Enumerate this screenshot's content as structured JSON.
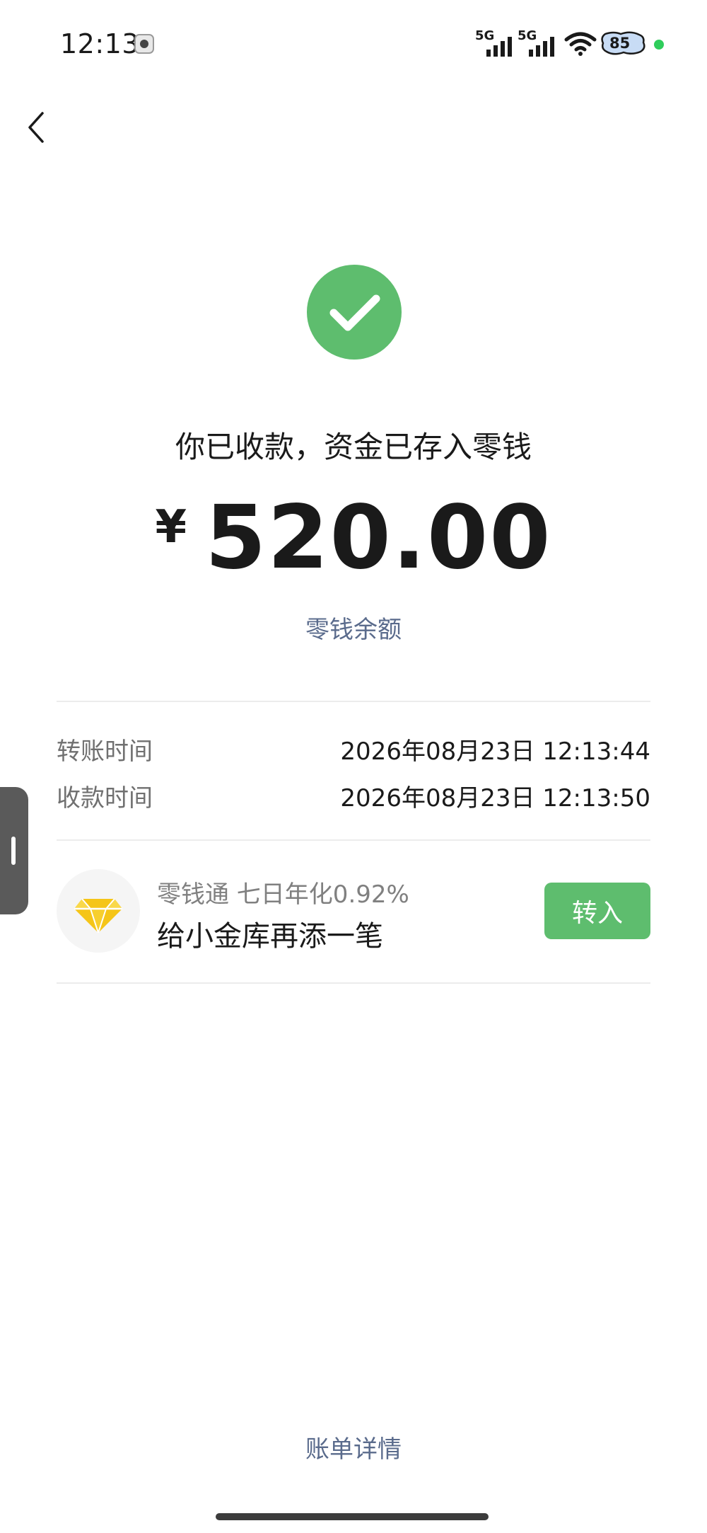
{
  "status_bar": {
    "time": "12:13",
    "signal1_label": "5G",
    "signal2_label": "5G",
    "battery_level": "85",
    "icons": [
      "screen-record-icon",
      "signal-icon",
      "wifi-icon",
      "battery-icon",
      "privacy-dot-icon"
    ]
  },
  "nav": {
    "back_icon": "chevron-left-icon"
  },
  "receipt": {
    "status_icon": "check-icon",
    "headline": "你已收款，资金已存入零钱",
    "currency": "¥",
    "amount": "520.00",
    "balance_link": "零钱余额"
  },
  "details": {
    "rows": [
      {
        "label": "转账时间",
        "value": "2026年08月23日 12:13:44"
      },
      {
        "label": "收款时间",
        "value": "2026年08月23日 12:13:50"
      }
    ]
  },
  "promo": {
    "icon": "diamond-icon",
    "subtitle": "零钱通 七日年化0.92%",
    "title": "给小金库再添一笔",
    "button_label": "转入"
  },
  "footer": {
    "bill_details_link": "账单详情"
  },
  "colors": {
    "accent_green": "#5ebd6e",
    "link_blue": "#5a6b8c",
    "diamond_yellow": "#f5c518"
  }
}
